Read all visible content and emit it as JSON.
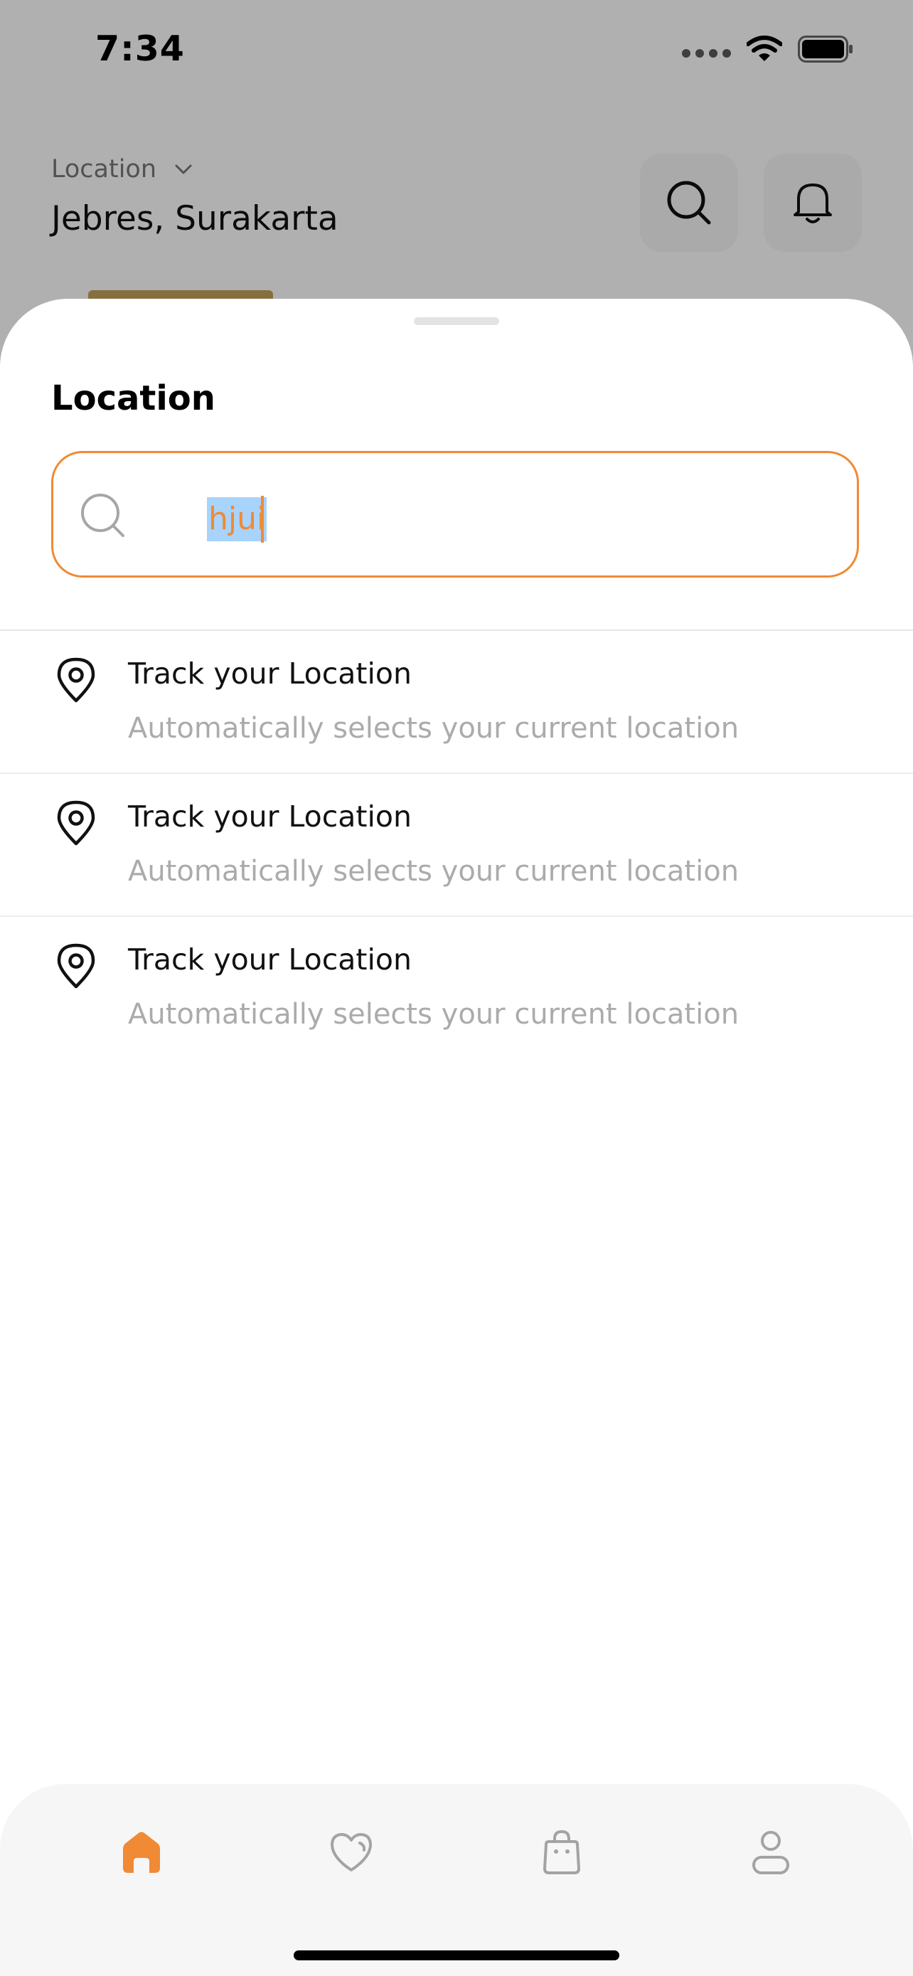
{
  "status_bar": {
    "time": "7:34",
    "icons": [
      "cellular-dots-icon",
      "wifi-icon",
      "battery-icon"
    ]
  },
  "header": {
    "location_caption": "Location",
    "location_value": "Jebres, Surakarta",
    "icons": [
      "chevron-down-icon",
      "search-icon",
      "bell-icon"
    ]
  },
  "sheet": {
    "title": "Location",
    "search": {
      "value": "hjui",
      "icon": "search-icon"
    },
    "items": [
      {
        "title": "Track your Location",
        "subtitle": "Automatically selects your current location",
        "icon": "location-pin-icon"
      },
      {
        "title": "Track your Location",
        "subtitle": "Automatically selects your current location",
        "icon": "location-pin-icon"
      },
      {
        "title": "Track your Location",
        "subtitle": "Automatically selects your current location",
        "icon": "location-pin-icon"
      }
    ]
  },
  "bottom_nav": {
    "items": [
      {
        "name": "home",
        "icon": "home-icon",
        "active": true
      },
      {
        "name": "favorites",
        "icon": "heart-icon",
        "active": false
      },
      {
        "name": "bag",
        "icon": "shopping-bag-icon",
        "active": false
      },
      {
        "name": "profile",
        "icon": "user-icon",
        "active": false
      }
    ]
  },
  "colors": {
    "accent": "#F08A34",
    "text_primary": "#111111",
    "text_secondary": "#ABABAB",
    "selection": "#A8D3FB"
  }
}
